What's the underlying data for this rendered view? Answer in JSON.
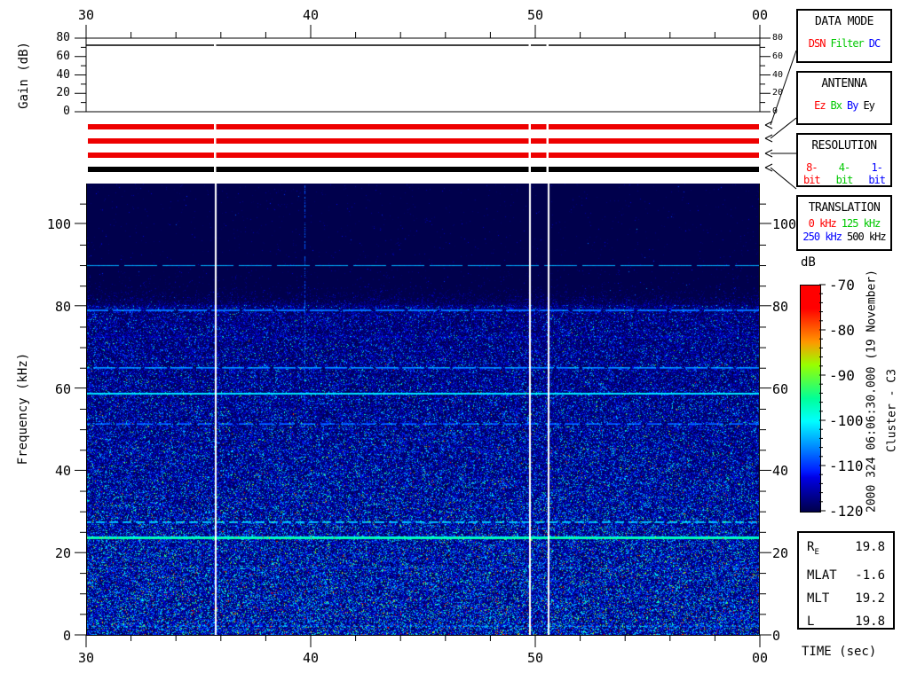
{
  "top_axis": {
    "tick_labels": [
      "30",
      "40",
      "50",
      "00"
    ]
  },
  "bottom_axis": {
    "tick_labels": [
      "30",
      "40",
      "50",
      "00"
    ],
    "xlabel": "TIME (sec)"
  },
  "gain_panel": {
    "ylabel": "Gain (dB)",
    "tick_labels": [
      "80",
      "60",
      "40",
      "20",
      "0"
    ],
    "trace_db": 72
  },
  "freq_axis": {
    "ylabel": "Frequency (kHz)",
    "tick_labels": [
      "100",
      "80",
      "60",
      "40",
      "20",
      "0"
    ]
  },
  "status_bars": [
    {
      "category": "DATA MODE",
      "selected": "DSN",
      "color": "#ee0000"
    },
    {
      "category": "ANTENNA",
      "selected": "Ez",
      "color": "#ee0000"
    },
    {
      "category": "RESOLUTION",
      "selected": "8-bit",
      "color": "#ee0000"
    },
    {
      "category": "TRANSLATION",
      "selected": "500 kHz",
      "color": "#000000"
    }
  ],
  "legend_boxes": [
    {
      "title": "DATA MODE",
      "rows": [
        [
          {
            "label": "DSN",
            "color": "#ff0000"
          },
          {
            "label": "Filter",
            "color": "#00c800"
          },
          {
            "label": "DC",
            "color": "#0000ff"
          }
        ]
      ]
    },
    {
      "title": "ANTENNA",
      "rows": [
        [
          {
            "label": "Ez",
            "color": "#ff0000"
          },
          {
            "label": "Bx",
            "color": "#00c800"
          },
          {
            "label": "By",
            "color": "#0000ff"
          },
          {
            "label": "Ey",
            "color": "#000000"
          }
        ]
      ]
    },
    {
      "title": "RESOLUTION",
      "rows": [
        [
          {
            "label": "8-bit",
            "color": "#ff0000"
          },
          {
            "label": "4-bit",
            "color": "#00c800"
          },
          {
            "label": "1-bit",
            "color": "#0000ff"
          }
        ]
      ]
    },
    {
      "title": "TRANSLATION",
      "rows": [
        [
          {
            "label": "0 kHz",
            "color": "#ff0000"
          },
          {
            "label": "125 kHz",
            "color": "#00c800"
          }
        ],
        [
          {
            "label": "250 kHz",
            "color": "#0000ff"
          },
          {
            "label": "500 kHz",
            "color": "#000000"
          }
        ]
      ]
    }
  ],
  "colorbar": {
    "title": "dB",
    "tick_labels": [
      "-70",
      "-80",
      "-90",
      "-100",
      "-110",
      "-120"
    ]
  },
  "annotations": {
    "datetime": "2000 324 06:06:30.000 (19 November)",
    "spacecraft": "Cluster - C3"
  },
  "info_box": {
    "rows": [
      {
        "label": "R",
        "sub": "E",
        "value": "19.8"
      },
      {
        "label": "MLAT",
        "sub": "",
        "value": "-1.6"
      },
      {
        "label": "MLT",
        "sub": "",
        "value": "19.2"
      },
      {
        "label": "L",
        "sub": "",
        "value": "19.8"
      }
    ]
  },
  "chart_data": {
    "type": "heatmap",
    "title": "Cluster C3 WBD wideband spectrogram",
    "xlabel": "TIME (sec)",
    "ylabel": "Frequency (kHz)",
    "x_range_sec": [
      30,
      60
    ],
    "x_tick_labels": [
      "30",
      "40",
      "50",
      "00"
    ],
    "freq_range_khz": [
      0,
      110
    ],
    "freq_ticks_khz": [
      0,
      20,
      40,
      60,
      80,
      100
    ],
    "colorbar_range_db": [
      -120,
      -70
    ],
    "colorbar_ticks_db": [
      -70,
      -80,
      -90,
      -100,
      -110,
      -120
    ],
    "gain_db": 72,
    "noise_floor_khz": 80.5,
    "background_db": -121,
    "spectral_lines": [
      {
        "freq_khz": 90.0,
        "level_db": -104,
        "dash": [
          43,
          37
        ]
      },
      {
        "freq_khz": 79.1,
        "level_db": -105,
        "dash": [
          37,
          32
        ]
      },
      {
        "freq_khz": 72.6,
        "level_db": -112,
        "p": 0.45
      },
      {
        "freq_khz": 65.1,
        "level_db": -104,
        "dash": [
          29,
          25
        ]
      },
      {
        "freq_khz": 58.8,
        "level_db": -100,
        "w": 0.26
      },
      {
        "freq_khz": 51.4,
        "level_db": -106,
        "dash": [
          23,
          16
        ]
      },
      {
        "freq_khz": 44.8,
        "level_db": -113,
        "p": 0.35
      },
      {
        "freq_khz": 27.5,
        "level_db": -101,
        "dash": [
          15,
          10
        ],
        "w": 0.22
      },
      {
        "freq_khz": 23.6,
        "level_db": -95,
        "w": 0.33
      },
      {
        "freq_khz": 16.3,
        "level_db": -110,
        "dash": [
          11,
          6
        ]
      },
      {
        "freq_khz": 2.1,
        "level_db": -105,
        "dash": [
          7,
          3
        ]
      }
    ],
    "data_gaps_sec": [
      35.73,
      49.73,
      50.56
    ],
    "vertical_event_sec": 39.73
  }
}
